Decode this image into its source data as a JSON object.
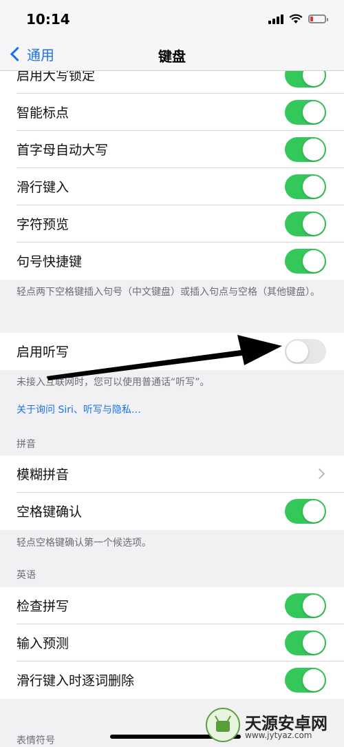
{
  "status": {
    "time": "10:14"
  },
  "nav": {
    "back_label": "通用",
    "title": "键盘"
  },
  "group1": [
    {
      "label": "启用大写锁定",
      "on": true
    },
    {
      "label": "智能标点",
      "on": true
    },
    {
      "label": "首字母自动大写",
      "on": true
    },
    {
      "label": "滑行键入",
      "on": true
    },
    {
      "label": "字符预览",
      "on": true
    },
    {
      "label": "句号快捷键",
      "on": true
    }
  ],
  "group1_footer": "轻点两下空格键插入句号（中文键盘）或插入句点与空格（其他键盘）。",
  "dictation": {
    "label": "启用听写",
    "on": false
  },
  "dictation_footer": "未接入互联网时，您可以使用普通话“听写”。",
  "dictation_link": "关于询问 Siri、听写与隐私…",
  "pinyin": {
    "header": "拼音",
    "rows": [
      {
        "label": "模糊拼音"
      },
      {
        "label": "空格键确认",
        "on": true
      }
    ],
    "footer": "轻点空格键确认第一个候选项。"
  },
  "english": {
    "header": "英语",
    "rows": [
      {
        "label": "检查拼写",
        "on": true
      },
      {
        "label": "输入预测",
        "on": true
      },
      {
        "label": "滑行键入时逐词删除",
        "on": true
      }
    ]
  },
  "emoji_header": "表情符号",
  "watermark": {
    "text": "天源安卓网",
    "url": "www.jytyaz.com"
  },
  "colors": {
    "accent": "#1b72e8",
    "toggle_on": "#34c759",
    "background": "#f1f1f4"
  }
}
